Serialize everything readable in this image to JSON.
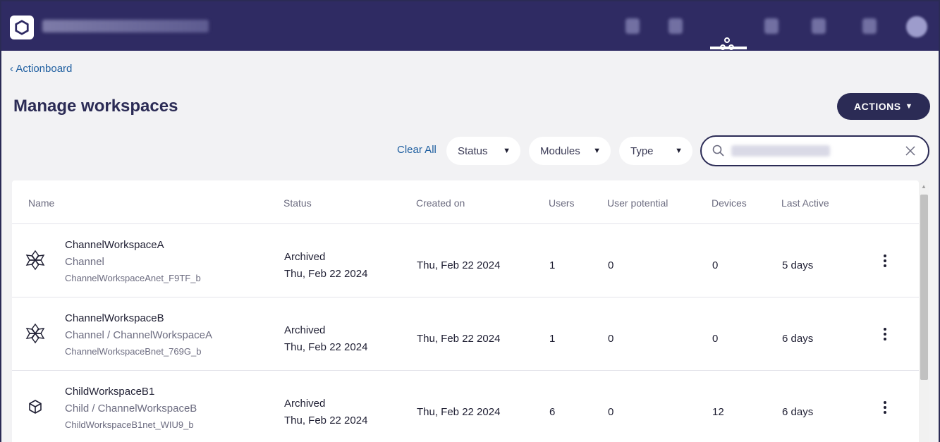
{
  "topbar": {
    "channel_name": "TEST_CONS_MAIN_CHANNEL",
    "bg_color": "#2f2b63",
    "icons": [
      {
        "name": "monitor-icon",
        "active": false
      },
      {
        "name": "bell-icon",
        "active": false
      },
      {
        "name": "workspaces-icon",
        "active": true
      },
      {
        "name": "rocket-icon",
        "active": false
      },
      {
        "name": "document-icon",
        "active": false
      },
      {
        "name": "gear-icon",
        "active": false
      }
    ]
  },
  "breadcrumb": {
    "label": "‹ Actionboard"
  },
  "page": {
    "title": "Manage workspaces"
  },
  "actions": {
    "label": "ACTIONS"
  },
  "filters": {
    "clear_all": "Clear All",
    "status": "Status",
    "modules": "Modules",
    "type": "Type"
  },
  "search": {
    "value": "ChannelWorkspace"
  },
  "table": {
    "columns": [
      "Name",
      "Status",
      "Created on",
      "Users",
      "User potential",
      "Devices",
      "Last Active"
    ],
    "rows": [
      {
        "icon": "channel-workspace-icon",
        "name": "ChannelWorkspaceA",
        "type": "Channel",
        "net": "ChannelWorkspaceAnet_F9TF_b",
        "status": "Archived",
        "status_date": "Thu, Feb 22 2024",
        "created": "Thu, Feb 22 2024",
        "users": "1",
        "potential": "0",
        "devices": "0",
        "last_active": "5 days"
      },
      {
        "icon": "channel-workspace-icon",
        "name": "ChannelWorkspaceB",
        "type": "Channel / ChannelWorkspaceA",
        "net": "ChannelWorkspaceBnet_769G_b",
        "status": "Archived",
        "status_date": "Thu, Feb 22 2024",
        "created": "Thu, Feb 22 2024",
        "users": "1",
        "potential": "0",
        "devices": "0",
        "last_active": "6 days"
      },
      {
        "icon": "child-workspace-icon",
        "name": "ChildWorkspaceB1",
        "type": "Child / ChannelWorkspaceB",
        "net": "ChildWorkspaceB1net_WIU9_b",
        "status": "Archived",
        "status_date": "Thu, Feb 22 2024",
        "created": "Thu, Feb 22 2024",
        "users": "6",
        "potential": "0",
        "devices": "12",
        "last_active": "6 days"
      }
    ]
  },
  "colors": {
    "navy": "#2b2b55",
    "link": "#1f5fa0",
    "page_bg": "#f2f2f4"
  }
}
